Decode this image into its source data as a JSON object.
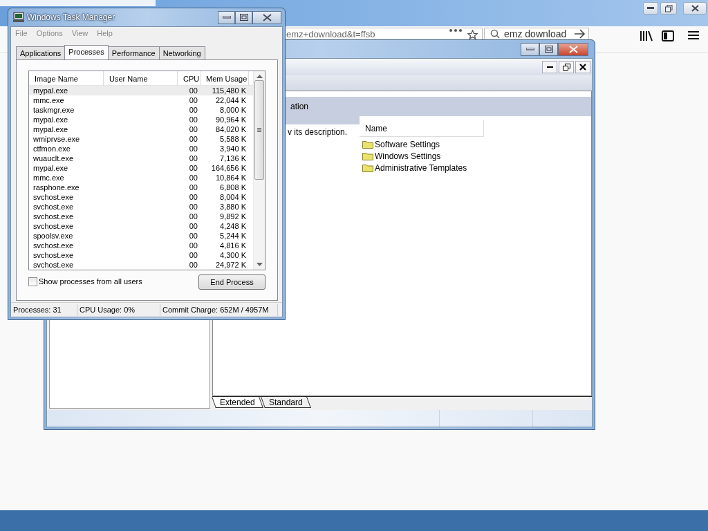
{
  "browser": {
    "address_text": "emz+download&t=ffsb",
    "search_text": "emz download"
  },
  "mmc": {
    "header_text": "ation",
    "description": "v its description.",
    "list_column": "Name",
    "items": [
      "Software Settings",
      "Windows Settings",
      "Administrative Templates"
    ],
    "view_tabs": [
      {
        "label": "Extended",
        "selected": true
      },
      {
        "label": "Standard",
        "selected": false
      }
    ]
  },
  "task_manager": {
    "title": "Windows Task Manager",
    "menu": [
      "File",
      "Options",
      "View",
      "Help"
    ],
    "tabs": [
      {
        "label": "Applications",
        "selected": false
      },
      {
        "label": "Processes",
        "selected": true
      },
      {
        "label": "Performance",
        "selected": false
      },
      {
        "label": "Networking",
        "selected": false
      }
    ],
    "columns": [
      "Image Name",
      "User Name",
      "CPU",
      "Mem Usage"
    ],
    "rows": [
      {
        "image_name": "mypal.exe",
        "cpu": "00",
        "mem_usage": "115,480 K",
        "selected": true
      },
      {
        "image_name": "mmc.exe",
        "cpu": "00",
        "mem_usage": "22,044 K",
        "selected": false
      },
      {
        "image_name": "taskmgr.exe",
        "cpu": "00",
        "mem_usage": "8,000 K",
        "selected": false
      },
      {
        "image_name": "mypal.exe",
        "cpu": "00",
        "mem_usage": "90,964 K",
        "selected": false
      },
      {
        "image_name": "mypal.exe",
        "cpu": "00",
        "mem_usage": "84,020 K",
        "selected": false
      },
      {
        "image_name": "wmiprvse.exe",
        "cpu": "00",
        "mem_usage": "5,588 K",
        "selected": false
      },
      {
        "image_name": "ctfmon.exe",
        "cpu": "00",
        "mem_usage": "3,940 K",
        "selected": false
      },
      {
        "image_name": "wuauclt.exe",
        "cpu": "00",
        "mem_usage": "7,136 K",
        "selected": false
      },
      {
        "image_name": "mypal.exe",
        "cpu": "00",
        "mem_usage": "164,656 K",
        "selected": false
      },
      {
        "image_name": "mmc.exe",
        "cpu": "00",
        "mem_usage": "10,864 K",
        "selected": false
      },
      {
        "image_name": "rasphone.exe",
        "cpu": "00",
        "mem_usage": "6,808 K",
        "selected": false
      },
      {
        "image_name": "svchost.exe",
        "cpu": "00",
        "mem_usage": "8,004 K",
        "selected": false
      },
      {
        "image_name": "svchost.exe",
        "cpu": "00",
        "mem_usage": "3,880 K",
        "selected": false
      },
      {
        "image_name": "svchost.exe",
        "cpu": "00",
        "mem_usage": "9,892 K",
        "selected": false
      },
      {
        "image_name": "svchost.exe",
        "cpu": "00",
        "mem_usage": "4,248 K",
        "selected": false
      },
      {
        "image_name": "spoolsv.exe",
        "cpu": "00",
        "mem_usage": "5,244 K",
        "selected": false
      },
      {
        "image_name": "svchost.exe",
        "cpu": "00",
        "mem_usage": "4,816 K",
        "selected": false
      },
      {
        "image_name": "svchost.exe",
        "cpu": "00",
        "mem_usage": "4,300 K",
        "selected": false
      },
      {
        "image_name": "svchost.exe",
        "cpu": "00",
        "mem_usage": "24,972 K",
        "selected": false
      }
    ],
    "show_all_users": {
      "label": "Show processes from all users",
      "checked": false
    },
    "end_process_button": "End Process",
    "status_bar": [
      "Processes: 31",
      "CPU Usage: 0%",
      "Commit Charge: 652M / 4957M"
    ]
  }
}
